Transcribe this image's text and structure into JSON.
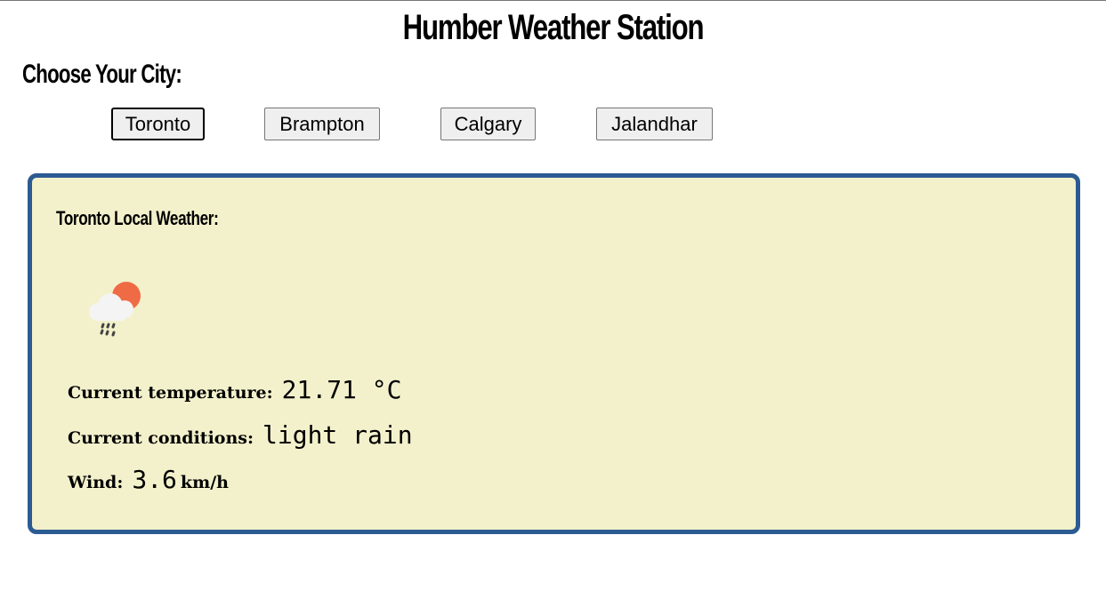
{
  "header": {
    "title": "Humber Weather Station",
    "city_heading": "Choose Your City:"
  },
  "cities": {
    "items": [
      {
        "label": "Toronto",
        "active": true
      },
      {
        "label": "Brampton",
        "active": false
      },
      {
        "label": "Calgary",
        "active": false
      },
      {
        "label": "Jalandhar",
        "active": false
      }
    ]
  },
  "weather": {
    "title": "Toronto Local Weather:",
    "icon": "cloud-sun-rain-icon",
    "temperature_label": "Current temperature:",
    "temperature_value": "21.71 °C",
    "conditions_label": "Current conditions:",
    "conditions_value": "light rain",
    "wind_label": "Wind:",
    "wind_value": "3.6",
    "wind_unit": "km/h"
  },
  "colors": {
    "card_background": "#f3f1cb",
    "card_border": "#2c5b93",
    "sun": "#ef6b45",
    "cloud": "#f4f4f4",
    "rain": "#444444"
  }
}
